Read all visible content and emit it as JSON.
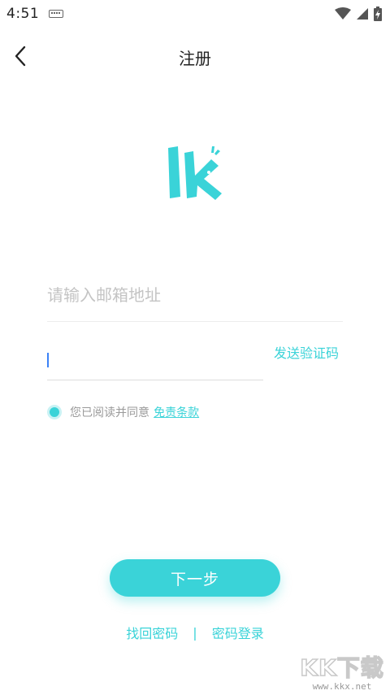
{
  "status_bar": {
    "time": "4:51",
    "icons": [
      "keyboard-icon",
      "wifi-icon",
      "signal-icon",
      "battery-charging-icon"
    ]
  },
  "header": {
    "title": "注册",
    "back_icon": "chevron-left-icon"
  },
  "logo": {
    "text": "lk",
    "color": "#3ad3d8"
  },
  "form": {
    "email_placeholder": "请输入邮箱地址",
    "email_value": "",
    "code_placeholder": "",
    "code_value": "",
    "send_code_label": "发送验证码",
    "agree_text": "您已阅读并同意",
    "terms_label": "免责条款"
  },
  "actions": {
    "next_label": "下一步",
    "find_password_label": "找回密码",
    "separator": "|",
    "password_login_label": "密码登录"
  },
  "watermark": {
    "title": "KK下载",
    "url": "www.kkx.net"
  },
  "colors": {
    "accent": "#3ad3d8",
    "text_gray": "#9a9a9a",
    "placeholder": "#c4c4c4"
  }
}
